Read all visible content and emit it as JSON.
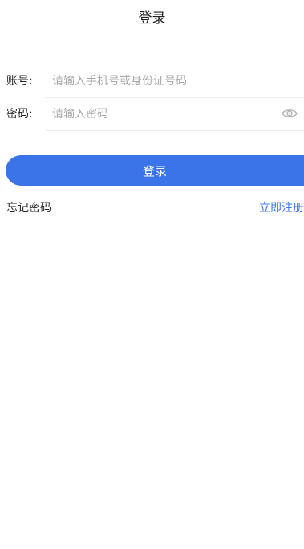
{
  "header": {
    "title": "登录"
  },
  "account": {
    "label": "账号:",
    "placeholder": "请输入手机号或身份证号码",
    "value": ""
  },
  "password": {
    "label": "密码:",
    "placeholder": "请输入密码",
    "value": "",
    "toggle_icon": "eye-icon"
  },
  "login_button": {
    "label": "登录"
  },
  "links": {
    "forgot": "忘记密码",
    "register": "立即注册"
  },
  "colors": {
    "primary": "#3b74e8",
    "placeholder": "#a8a8a8",
    "divider": "#ececec",
    "text": "#222222"
  }
}
